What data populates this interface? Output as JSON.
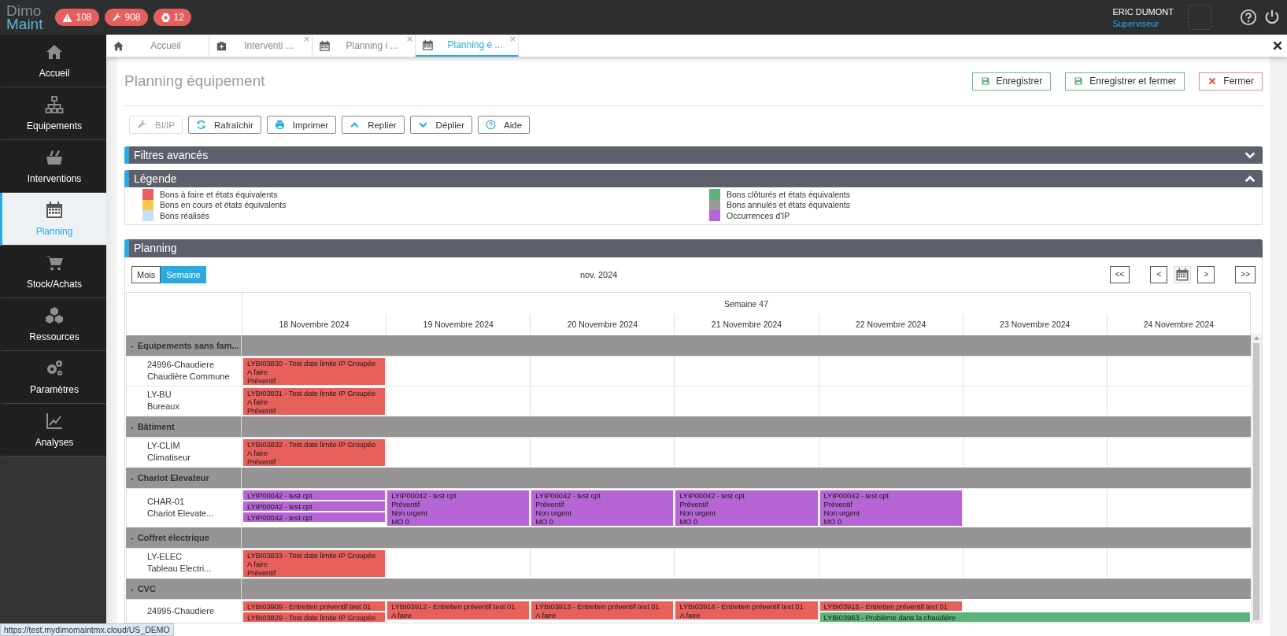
{
  "topbar": {
    "logo": [
      "Dimo",
      "Maint"
    ],
    "badges": [
      {
        "kind": "warning",
        "count": "108"
      },
      {
        "kind": "wrench",
        "count": "908"
      },
      {
        "kind": "nut",
        "count": "12"
      }
    ],
    "user": {
      "name": "ERIC DUMONT",
      "role": "Superviseur"
    }
  },
  "sidebar": {
    "items": [
      {
        "kind": "home",
        "label": "Accueil",
        "selected": false
      },
      {
        "kind": "tree",
        "label": "Equipements",
        "selected": false
      },
      {
        "kind": "toolbox",
        "label": "Interventions",
        "selected": false
      },
      {
        "kind": "calendar",
        "label": "Planning",
        "selected": true
      },
      {
        "kind": "cart",
        "label": "Stock/Achats",
        "selected": false
      },
      {
        "kind": "cubes",
        "label": "Ressources",
        "selected": false
      },
      {
        "kind": "gears",
        "label": "Paramètres",
        "selected": false
      },
      {
        "kind": "chart",
        "label": "Analyses",
        "selected": false
      }
    ]
  },
  "tabs": [
    {
      "kind": "home",
      "label": "Accueil",
      "selected": false,
      "closable": false
    },
    {
      "kind": "medkit",
      "label": "Interventi ...",
      "selected": false,
      "closable": true
    },
    {
      "kind": "calendar",
      "label": "Planning i ...",
      "selected": false,
      "closable": true
    },
    {
      "kind": "calendar",
      "label": "Planning é ...",
      "selected": true,
      "closable": true
    }
  ],
  "page": {
    "title": "Planning équipement",
    "actions": [
      {
        "kind": "save",
        "label": "Enregistrer"
      },
      {
        "kind": "save",
        "label": "Enregistrer et fermer"
      },
      {
        "kind": "close",
        "label": "Fermer"
      }
    ]
  },
  "toolbar": [
    {
      "kind": "wrench",
      "label": "BI/IP",
      "disabled": true
    },
    {
      "kind": "refresh",
      "label": "Rafraîchir",
      "disabled": false
    },
    {
      "kind": "print",
      "label": "Imprimer",
      "disabled": false
    },
    {
      "kind": "up",
      "label": "Replier",
      "disabled": false
    },
    {
      "kind": "down",
      "label": "Déplier",
      "disabled": false
    },
    {
      "kind": "help",
      "label": "Aide",
      "disabled": false
    }
  ],
  "filters": {
    "title": "Filtres avancés",
    "expanded": false
  },
  "legend": {
    "title": "Légende",
    "expanded": true,
    "items": [
      {
        "label": "Bons à faire et états équivalents",
        "color": "#e8605c"
      },
      {
        "label": "Bons en cours et états équivalents",
        "color": "#fbc84e"
      },
      {
        "label": "Bons réalisés",
        "color": "#c4e1f6"
      },
      {
        "label": "Bons clôturés et états équivalents",
        "color": "#5db37b"
      },
      {
        "label": "Bons annulés et états équivalents",
        "color": "#999999"
      },
      {
        "label": "Occurrences d'IP",
        "color": "#b565d4"
      }
    ]
  },
  "planning": {
    "title": "Planning",
    "views": [
      {
        "label": "Mois",
        "selected": false
      },
      {
        "label": "Semaine",
        "selected": true
      }
    ],
    "period": "nov. 2024",
    "nav": [
      {
        "kind": "first",
        "label": "<<"
      },
      {
        "kind": "prev",
        "label": "<"
      },
      {
        "kind": "calendar"
      },
      {
        "kind": "next",
        "label": ">"
      },
      {
        "kind": "last",
        "label": ">>"
      }
    ],
    "week": "Semaine 47",
    "days": [
      "18 Novembre 2024",
      "19 Novembre 2024",
      "20 Novembre 2024",
      "21 Novembre 2024",
      "22 Novembre 2024",
      "23 Novembre 2024",
      "24 Novembre 2024"
    ],
    "groups": [
      {
        "toggle": "-",
        "name": "Equipements sans fam...",
        "rows": [
          {
            "code": "24996-Chaudiere",
            "name": "Chaudière Commune",
            "cells": [
              {
                "events": [
                  {
                    "kind": "todo",
                    "extends": false,
                    "lines": [
                      "LYBI03830 - Test date limite IP Groupée",
                      "A faire",
                      "Préventif"
                    ]
                  }
                ]
              },
              {},
              {},
              {},
              {},
              {},
              {}
            ]
          },
          {
            "code": "LY-BU",
            "name": "Bureaux",
            "cells": [
              {
                "events": [
                  {
                    "kind": "todo",
                    "extends": false,
                    "lines": [
                      "LYBI03831 - Test date limite IP Groupée",
                      "A faire",
                      "Préventif"
                    ]
                  }
                ]
              },
              {},
              {},
              {},
              {},
              {},
              {}
            ]
          }
        ]
      },
      {
        "toggle": "-",
        "name": "Bâtiment",
        "rows": [
          {
            "code": "LY-CLIM",
            "name": "Climatiseur",
            "cells": [
              {
                "events": [
                  {
                    "kind": "todo",
                    "extends": false,
                    "lines": [
                      "LYBI03832 - Test date limite IP Groupée",
                      "A faire",
                      "Préventif"
                    ]
                  }
                ]
              },
              {},
              {},
              {},
              {},
              {},
              {}
            ]
          }
        ]
      },
      {
        "toggle": "-",
        "name": "Chariot Elevateur",
        "rows": [
          {
            "code": "CHAR-01",
            "name": "Chariot Elevate...",
            "cells": [
              {
                "events": [
                  {
                    "kind": "ip",
                    "extends": false,
                    "lines": [
                      "LYIP00042 - test cpt"
                    ]
                  },
                  {
                    "kind": "ip",
                    "extends": false,
                    "lines": [
                      "LYIP00042 - test cpt"
                    ]
                  },
                  {
                    "kind": "ip",
                    "extends": false,
                    "lines": [
                      "LYIP00042 - test cpt"
                    ]
                  }
                ]
              },
              {
                "events": [
                  {
                    "kind": "ip",
                    "extends": false,
                    "lines": [
                      "LYIP00042 - test cpt",
                      "Préventif",
                      "Non urgent",
                      "MO 0"
                    ]
                  }
                ]
              },
              {
                "events": [
                  {
                    "kind": "ip",
                    "extends": false,
                    "lines": [
                      "LYIP00042 - test cpt",
                      "Préventif",
                      "Non urgent",
                      "MO 0"
                    ]
                  }
                ]
              },
              {
                "events": [
                  {
                    "kind": "ip",
                    "extends": false,
                    "lines": [
                      "LYIP00042 - test cpt",
                      "Préventif",
                      "Non urgent",
                      "MO 0"
                    ]
                  }
                ]
              },
              {
                "events": [
                  {
                    "kind": "ip",
                    "extends": false,
                    "lines": [
                      "LYIP00042 - test cpt",
                      "Préventif",
                      "Non urgent",
                      "MO 0"
                    ]
                  }
                ]
              },
              {},
              {}
            ]
          }
        ]
      },
      {
        "toggle": "-",
        "name": "Coffret électrique",
        "rows": [
          {
            "code": "LY-ELEC",
            "name": "Tableau Electri...",
            "cells": [
              {
                "events": [
                  {
                    "kind": "todo",
                    "extends": false,
                    "lines": [
                      "LYBI03833 - Test date limite IP Groupée",
                      "A faire",
                      "Préventif"
                    ]
                  }
                ]
              },
              {},
              {},
              {},
              {},
              {},
              {}
            ]
          }
        ]
      },
      {
        "toggle": "-",
        "name": "CVC",
        "rows": [
          {
            "code": "24995-Chaudiere",
            "cells": [
              {
                "events": [
                  {
                    "kind": "todo",
                    "extends": false,
                    "lines": [
                      "LYBI03909 - Entretien préventif test 01"
                    ]
                  },
                  {
                    "kind": "todo",
                    "extends": false,
                    "lines": [
                      "LYBI03829 - Test date limite IP Groupée"
                    ]
                  }
                ]
              },
              {
                "events": [
                  {
                    "kind": "todo",
                    "extends": false,
                    "lines": [
                      "LYBI03912 - Entretien préventif test 01",
                      "A faire"
                    ]
                  }
                ]
              },
              {
                "events": [
                  {
                    "kind": "todo",
                    "extends": false,
                    "lines": [
                      "LYBI03913 - Entretien préventif test 01",
                      "A faire"
                    ]
                  }
                ]
              },
              {
                "events": [
                  {
                    "kind": "todo",
                    "extends": false,
                    "lines": [
                      "LYBI03914 - Entretien préventif test 01",
                      "A faire"
                    ]
                  }
                ]
              },
              {
                "events": [
                  {
                    "kind": "todo",
                    "extends": false,
                    "lines": [
                      "LYBI03915 - Entretien préventif test 01"
                    ]
                  },
                  {
                    "kind": "closed",
                    "extends": true,
                    "lines": [
                      "LYBI03963 - Problème dans la chaudière"
                    ]
                  }
                ]
              },
              {},
              {}
            ]
          }
        ]
      }
    ]
  },
  "status_url": "https://test.mydimomaintmx.cloud/US_DEMO"
}
